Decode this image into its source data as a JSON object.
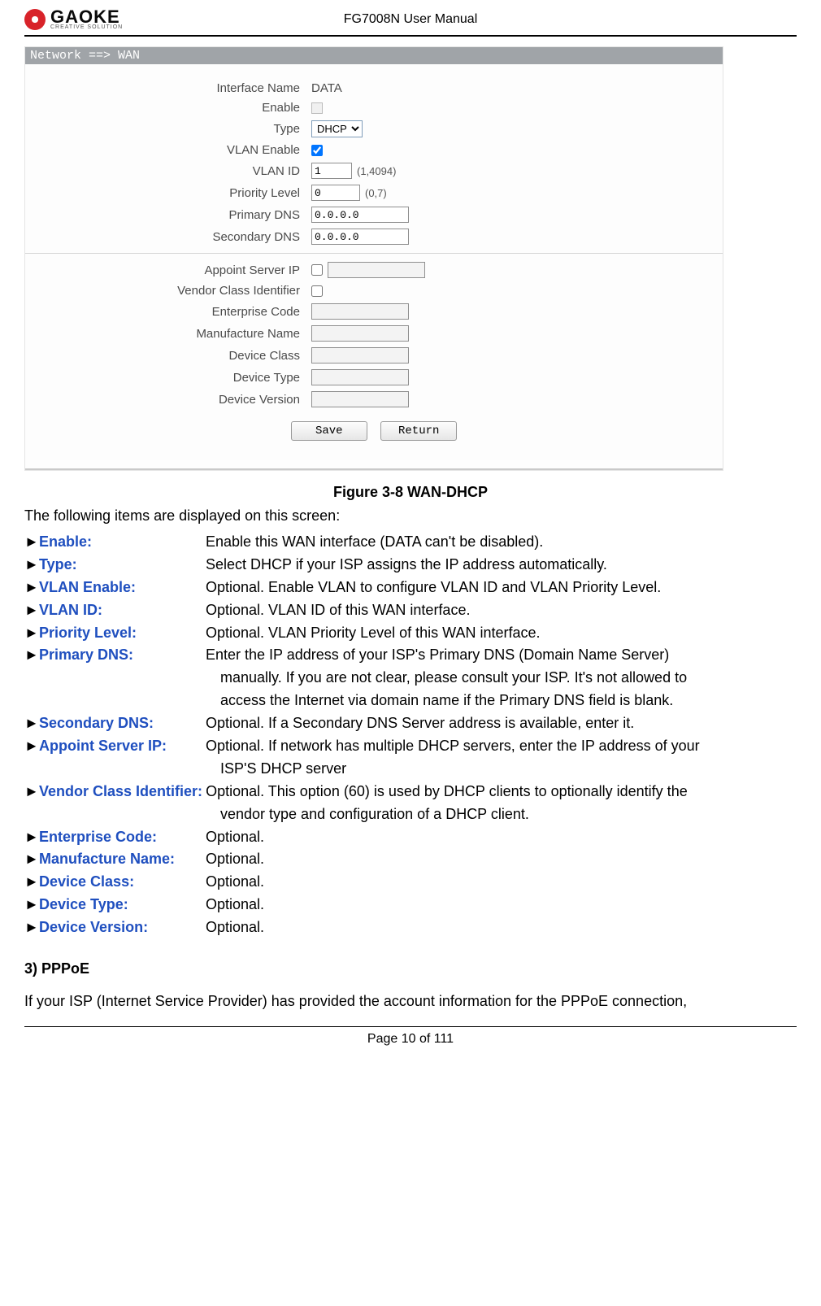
{
  "header": {
    "doc_title": "FG7008N User Manual",
    "logo_text": "GAOKE",
    "logo_sub": "CREATIVE SOLUTION"
  },
  "panel": {
    "crumb": "Network ==> WAN",
    "rows1": {
      "iface_label": "Interface Name",
      "iface_value": "DATA",
      "enable_label": "Enable",
      "type_label": "Type",
      "type_value": "DHCP",
      "vlan_enable_label": "VLAN Enable",
      "vlan_id_label": "VLAN ID",
      "vlan_id_value": "1",
      "vlan_id_hint": "(1,4094)",
      "prio_label": "Priority Level",
      "prio_value": "0",
      "prio_hint": "(0,7)",
      "pdns_label": "Primary DNS",
      "pdns_value": "0.0.0.0",
      "sdns_label": "Secondary DNS",
      "sdns_value": "0.0.0.0"
    },
    "rows2": {
      "appoint_label": "Appoint Server IP",
      "vci_label": "Vendor Class Identifier",
      "ec_label": "Enterprise Code",
      "mn_label": "Manufacture Name",
      "dc_label": "Device Class",
      "dt_label": "Device Type",
      "dv_label": "Device Version"
    },
    "buttons": {
      "save": "Save",
      "return": "Return"
    }
  },
  "caption": "Figure 3-8    WAN-DHCP",
  "lead": "The following items are displayed on this screen:",
  "items": [
    {
      "term": "Enable:",
      "desc": "Enable this WAN interface (DATA can't be disabled)."
    },
    {
      "term": "Type:",
      "desc": "Select DHCP if your ISP assigns the IP address automatically."
    },
    {
      "term": "VLAN Enable:",
      "desc": "Optional. Enable VLAN to configure VLAN ID and VLAN Priority Level."
    },
    {
      "term": "VLAN ID:",
      "desc": "Optional. VLAN ID of this WAN interface."
    },
    {
      "term": "Priority Level:",
      "desc": "Optional. VLAN Priority Level of this WAN interface."
    },
    {
      "term": "Primary DNS:",
      "desc": "Enter the IP address of your ISP's Primary DNS (Domain Name Server)"
    },
    {
      "cont": "manually. If you are not clear, please consult your ISP. It's not allowed to"
    },
    {
      "cont": "access the Internet via domain name if the Primary DNS field is blank."
    },
    {
      "term": "Secondary DNS:",
      "desc": "Optional. If a Secondary DNS Server address is available, enter it."
    },
    {
      "term": "Appoint Server IP:",
      "desc": "Optional. If network has multiple DHCP servers, enter the IP address of your"
    },
    {
      "cont": "ISP'S DHCP server"
    },
    {
      "term": "Vendor Class Identifier:",
      "desc": "Optional. This option (60) is used by DHCP clients to optionally identify the",
      "tight": true
    },
    {
      "cont": "vendor type and configuration of a DHCP client."
    },
    {
      "term": "Enterprise Code:",
      "desc": "Optional."
    },
    {
      "term": "Manufacture Name:",
      "desc": "Optional."
    },
    {
      "term": "Device Class:",
      "desc": "Optional."
    },
    {
      "term": "Device Type:",
      "desc": "Optional."
    },
    {
      "term": "Device Version:",
      "desc": "Optional."
    }
  ],
  "section3": "3) PPPoE",
  "pppoe_text": "If your ISP (Internet Service Provider) has provided the account information for the PPPoE connection,",
  "footer": "Page 10 of 111"
}
